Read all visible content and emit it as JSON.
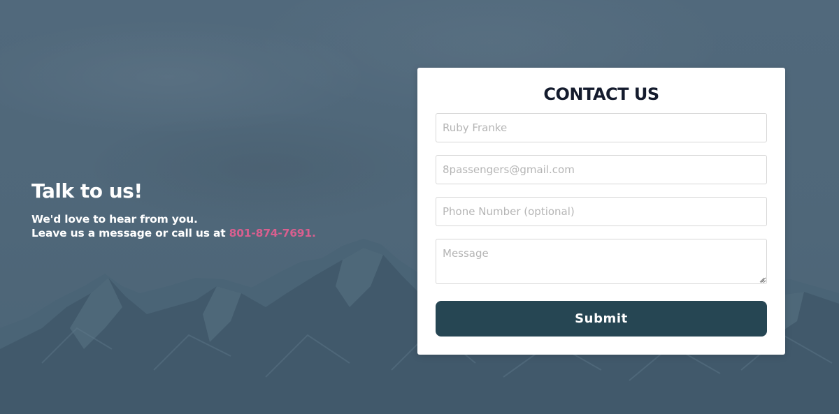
{
  "intro": {
    "title": "Talk to us!",
    "line1": "We'd love to hear from you.",
    "line2_prefix": "Leave us a message or call us at ",
    "phone": "801-874-7691."
  },
  "contact_form": {
    "title": "CONTACT US",
    "name_placeholder": "Ruby Franke",
    "email_placeholder": "8passengers@gmail.com",
    "phone_placeholder": "Phone Number (optional)",
    "message_placeholder": "Message",
    "submit_label": "Submit"
  },
  "colors": {
    "background": "#4f6a7e",
    "mountains": "#3f5a6d",
    "card_background": "#ffffff",
    "title_text": "#141b2d",
    "submit_background": "#264653",
    "phone_link": "#d95f8f"
  }
}
